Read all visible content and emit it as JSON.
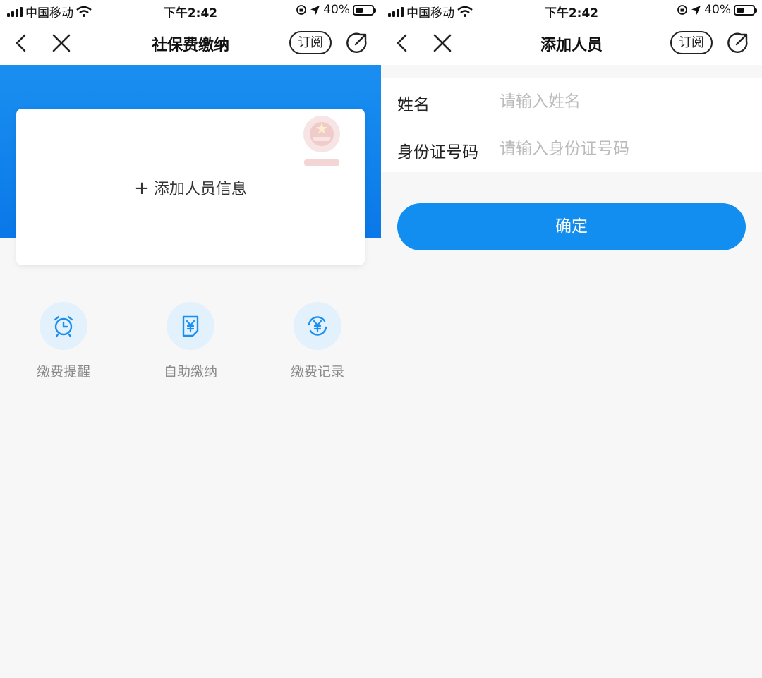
{
  "status_bar": {
    "carrier": "中国移动",
    "time": "下午2:42",
    "battery": "40%"
  },
  "left_screen": {
    "nav": {
      "title": "社保费缴纳",
      "subscribe_label": "订阅"
    },
    "card": {
      "add_label": "添加人员信息",
      "plus": "+"
    },
    "shortcuts": [
      {
        "label": "缴费提醒",
        "icon": "alarm-clock-icon"
      },
      {
        "label": "自助缴纳",
        "icon": "yuan-document-icon"
      },
      {
        "label": "缴费记录",
        "icon": "yuan-refresh-icon"
      }
    ],
    "colors": {
      "banner": "#0a78e8",
      "icon_bg": "#e3f1fd",
      "icon": "#1a8ff0"
    }
  },
  "right_screen": {
    "nav": {
      "title": "添加人员",
      "subscribe_label": "订阅"
    },
    "form": {
      "name_label": "姓名",
      "name_placeholder": "请输入姓名",
      "id_label": "身份证号码",
      "id_placeholder": "请输入身份证号码"
    },
    "confirm_label": "确定",
    "colors": {
      "button": "#118ef0"
    }
  }
}
